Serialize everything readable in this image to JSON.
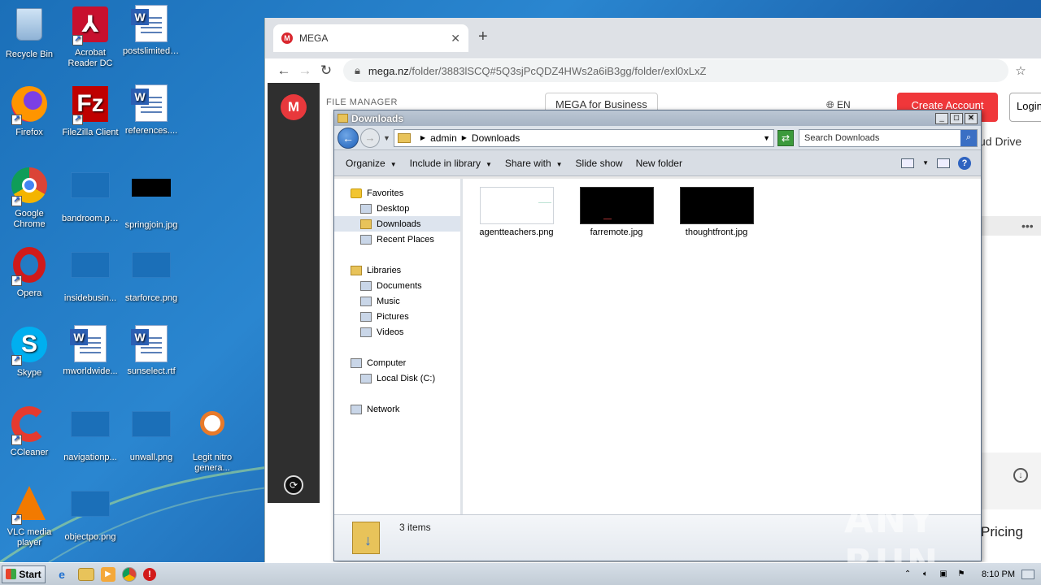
{
  "desktop": {
    "icons": [
      {
        "label": "Recycle Bin",
        "icon": "recycle-bin-icon"
      },
      {
        "label": "Acrobat Reader DC",
        "icon": "acrobat-icon"
      },
      {
        "label": "postslimited....",
        "icon": "word-doc-icon"
      },
      {
        "label": "Firefox",
        "icon": "firefox-icon"
      },
      {
        "label": "FileZilla Client",
        "icon": "filezilla-icon"
      },
      {
        "label": "references....",
        "icon": "word-doc-icon"
      },
      {
        "label": "Google Chrome",
        "icon": "chrome-icon"
      },
      {
        "label": "bandroom.png",
        "icon": "image-file-icon"
      },
      {
        "label": "springjoin.jpg",
        "icon": "image-file-icon"
      },
      {
        "label": "Opera",
        "icon": "opera-icon"
      },
      {
        "label": "insidebusin...",
        "icon": "image-file-icon"
      },
      {
        "label": "starforce.png",
        "icon": "image-file-icon"
      },
      {
        "label": "Skype",
        "icon": "skype-icon"
      },
      {
        "label": "mworldwide...",
        "icon": "word-doc-icon"
      },
      {
        "label": "sunselect.rtf",
        "icon": "word-doc-icon"
      },
      {
        "label": "CCleaner",
        "icon": "ccleaner-icon"
      },
      {
        "label": "navigationp...",
        "icon": "image-file-icon"
      },
      {
        "label": "unwall.png",
        "icon": "image-file-icon"
      },
      {
        "label": "Legit nitro genera...",
        "icon": "app-icon"
      },
      {
        "label": "VLC media player",
        "icon": "vlc-icon"
      },
      {
        "label": "objectpo.png",
        "icon": "image-file-icon"
      }
    ]
  },
  "browser": {
    "tab_title": "MEGA",
    "url_domain": "mega.nz",
    "url_path": "/folder/3883lSCQ#5Q3sjPcQDZ4HWs2a6iB3gg/folder/exl0xLxZ",
    "page": {
      "file_manager": "FILE MANAGER",
      "business_btn": "MEGA for Business",
      "lang": "EN",
      "create_account": "Create Account",
      "login": "Login",
      "cloud_drive": "ud Drive",
      "more": "•••",
      "pricing": "Pricing"
    }
  },
  "explorer": {
    "title": "Downloads",
    "breadcrumb": [
      "admin",
      "Downloads"
    ],
    "search_placeholder": "Search Downloads",
    "commands": [
      "Organize",
      "Include in library",
      "Share with",
      "Slide show",
      "New folder"
    ],
    "nav": {
      "favorites": "Favorites",
      "fav_items": [
        "Desktop",
        "Downloads",
        "Recent Places"
      ],
      "libraries": "Libraries",
      "lib_items": [
        "Documents",
        "Music",
        "Pictures",
        "Videos"
      ],
      "computer": "Computer",
      "comp_items": [
        "Local Disk (C:)"
      ],
      "network": "Network"
    },
    "files": [
      {
        "name": "agentteachers.png",
        "thumb": "white"
      },
      {
        "name": "farremote.jpg",
        "thumb": "black"
      },
      {
        "name": "thoughtfront.jpg",
        "thumb": "black"
      }
    ],
    "status": "3 items"
  },
  "taskbar": {
    "start": "Start",
    "clock": "8:10 PM"
  },
  "watermark": "ANY RUN"
}
